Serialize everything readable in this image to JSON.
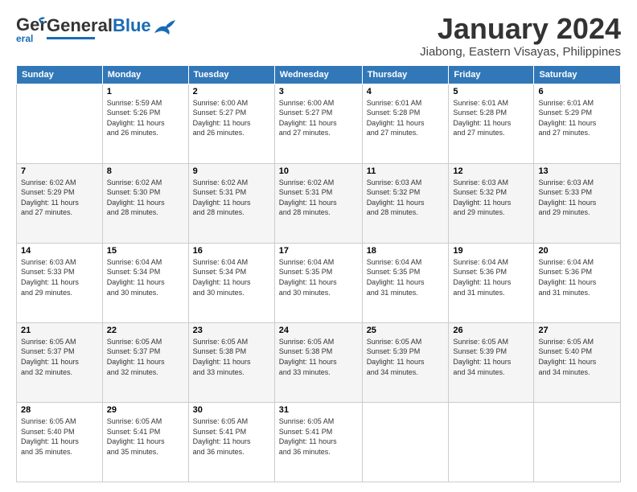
{
  "logo": {
    "general": "General",
    "blue": "Blue"
  },
  "header": {
    "title": "January 2024",
    "location": "Jiabong, Eastern Visayas, Philippines"
  },
  "weekdays": [
    "Sunday",
    "Monday",
    "Tuesday",
    "Wednesday",
    "Thursday",
    "Friday",
    "Saturday"
  ],
  "weeks": [
    [
      {
        "day": "",
        "lines": []
      },
      {
        "day": "1",
        "lines": [
          "Sunrise: 5:59 AM",
          "Sunset: 5:26 PM",
          "Daylight: 11 hours",
          "and 26 minutes."
        ]
      },
      {
        "day": "2",
        "lines": [
          "Sunrise: 6:00 AM",
          "Sunset: 5:27 PM",
          "Daylight: 11 hours",
          "and 26 minutes."
        ]
      },
      {
        "day": "3",
        "lines": [
          "Sunrise: 6:00 AM",
          "Sunset: 5:27 PM",
          "Daylight: 11 hours",
          "and 27 minutes."
        ]
      },
      {
        "day": "4",
        "lines": [
          "Sunrise: 6:01 AM",
          "Sunset: 5:28 PM",
          "Daylight: 11 hours",
          "and 27 minutes."
        ]
      },
      {
        "day": "5",
        "lines": [
          "Sunrise: 6:01 AM",
          "Sunset: 5:28 PM",
          "Daylight: 11 hours",
          "and 27 minutes."
        ]
      },
      {
        "day": "6",
        "lines": [
          "Sunrise: 6:01 AM",
          "Sunset: 5:29 PM",
          "Daylight: 11 hours",
          "and 27 minutes."
        ]
      }
    ],
    [
      {
        "day": "7",
        "lines": [
          "Sunrise: 6:02 AM",
          "Sunset: 5:29 PM",
          "Daylight: 11 hours",
          "and 27 minutes."
        ]
      },
      {
        "day": "8",
        "lines": [
          "Sunrise: 6:02 AM",
          "Sunset: 5:30 PM",
          "Daylight: 11 hours",
          "and 28 minutes."
        ]
      },
      {
        "day": "9",
        "lines": [
          "Sunrise: 6:02 AM",
          "Sunset: 5:31 PM",
          "Daylight: 11 hours",
          "and 28 minutes."
        ]
      },
      {
        "day": "10",
        "lines": [
          "Sunrise: 6:02 AM",
          "Sunset: 5:31 PM",
          "Daylight: 11 hours",
          "and 28 minutes."
        ]
      },
      {
        "day": "11",
        "lines": [
          "Sunrise: 6:03 AM",
          "Sunset: 5:32 PM",
          "Daylight: 11 hours",
          "and 28 minutes."
        ]
      },
      {
        "day": "12",
        "lines": [
          "Sunrise: 6:03 AM",
          "Sunset: 5:32 PM",
          "Daylight: 11 hours",
          "and 29 minutes."
        ]
      },
      {
        "day": "13",
        "lines": [
          "Sunrise: 6:03 AM",
          "Sunset: 5:33 PM",
          "Daylight: 11 hours",
          "and 29 minutes."
        ]
      }
    ],
    [
      {
        "day": "14",
        "lines": [
          "Sunrise: 6:03 AM",
          "Sunset: 5:33 PM",
          "Daylight: 11 hours",
          "and 29 minutes."
        ]
      },
      {
        "day": "15",
        "lines": [
          "Sunrise: 6:04 AM",
          "Sunset: 5:34 PM",
          "Daylight: 11 hours",
          "and 30 minutes."
        ]
      },
      {
        "day": "16",
        "lines": [
          "Sunrise: 6:04 AM",
          "Sunset: 5:34 PM",
          "Daylight: 11 hours",
          "and 30 minutes."
        ]
      },
      {
        "day": "17",
        "lines": [
          "Sunrise: 6:04 AM",
          "Sunset: 5:35 PM",
          "Daylight: 11 hours",
          "and 30 minutes."
        ]
      },
      {
        "day": "18",
        "lines": [
          "Sunrise: 6:04 AM",
          "Sunset: 5:35 PM",
          "Daylight: 11 hours",
          "and 31 minutes."
        ]
      },
      {
        "day": "19",
        "lines": [
          "Sunrise: 6:04 AM",
          "Sunset: 5:36 PM",
          "Daylight: 11 hours",
          "and 31 minutes."
        ]
      },
      {
        "day": "20",
        "lines": [
          "Sunrise: 6:04 AM",
          "Sunset: 5:36 PM",
          "Daylight: 11 hours",
          "and 31 minutes."
        ]
      }
    ],
    [
      {
        "day": "21",
        "lines": [
          "Sunrise: 6:05 AM",
          "Sunset: 5:37 PM",
          "Daylight: 11 hours",
          "and 32 minutes."
        ]
      },
      {
        "day": "22",
        "lines": [
          "Sunrise: 6:05 AM",
          "Sunset: 5:37 PM",
          "Daylight: 11 hours",
          "and 32 minutes."
        ]
      },
      {
        "day": "23",
        "lines": [
          "Sunrise: 6:05 AM",
          "Sunset: 5:38 PM",
          "Daylight: 11 hours",
          "and 33 minutes."
        ]
      },
      {
        "day": "24",
        "lines": [
          "Sunrise: 6:05 AM",
          "Sunset: 5:38 PM",
          "Daylight: 11 hours",
          "and 33 minutes."
        ]
      },
      {
        "day": "25",
        "lines": [
          "Sunrise: 6:05 AM",
          "Sunset: 5:39 PM",
          "Daylight: 11 hours",
          "and 34 minutes."
        ]
      },
      {
        "day": "26",
        "lines": [
          "Sunrise: 6:05 AM",
          "Sunset: 5:39 PM",
          "Daylight: 11 hours",
          "and 34 minutes."
        ]
      },
      {
        "day": "27",
        "lines": [
          "Sunrise: 6:05 AM",
          "Sunset: 5:40 PM",
          "Daylight: 11 hours",
          "and 34 minutes."
        ]
      }
    ],
    [
      {
        "day": "28",
        "lines": [
          "Sunrise: 6:05 AM",
          "Sunset: 5:40 PM",
          "Daylight: 11 hours",
          "and 35 minutes."
        ]
      },
      {
        "day": "29",
        "lines": [
          "Sunrise: 6:05 AM",
          "Sunset: 5:41 PM",
          "Daylight: 11 hours",
          "and 35 minutes."
        ]
      },
      {
        "day": "30",
        "lines": [
          "Sunrise: 6:05 AM",
          "Sunset: 5:41 PM",
          "Daylight: 11 hours",
          "and 36 minutes."
        ]
      },
      {
        "day": "31",
        "lines": [
          "Sunrise: 6:05 AM",
          "Sunset: 5:41 PM",
          "Daylight: 11 hours",
          "and 36 minutes."
        ]
      },
      {
        "day": "",
        "lines": []
      },
      {
        "day": "",
        "lines": []
      },
      {
        "day": "",
        "lines": []
      }
    ]
  ]
}
